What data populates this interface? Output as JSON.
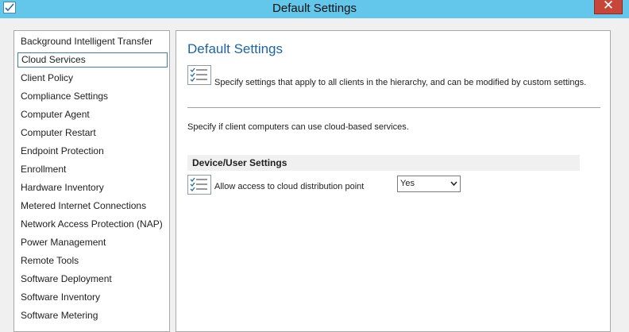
{
  "window": {
    "title": "Default Settings",
    "close_label": "✕"
  },
  "sidebar": {
    "items": [
      {
        "label": "Background Intelligent Transfer",
        "selected": false
      },
      {
        "label": "Cloud Services",
        "selected": true
      },
      {
        "label": "Client Policy",
        "selected": false
      },
      {
        "label": "Compliance Settings",
        "selected": false
      },
      {
        "label": "Computer Agent",
        "selected": false
      },
      {
        "label": "Computer Restart",
        "selected": false
      },
      {
        "label": "Endpoint Protection",
        "selected": false
      },
      {
        "label": "Enrollment",
        "selected": false
      },
      {
        "label": "Hardware Inventory",
        "selected": false
      },
      {
        "label": "Metered Internet Connections",
        "selected": false
      },
      {
        "label": "Network Access Protection (NAP)",
        "selected": false
      },
      {
        "label": "Power Management",
        "selected": false
      },
      {
        "label": "Remote Tools",
        "selected": false
      },
      {
        "label": "Software Deployment",
        "selected": false
      },
      {
        "label": "Software Inventory",
        "selected": false
      },
      {
        "label": "Software Metering",
        "selected": false
      }
    ]
  },
  "main": {
    "title": "Default Settings",
    "description": "Specify settings that apply to all clients in the hierarchy, and can be modified by custom settings.",
    "cloud_text": "Specify if client computers can use cloud-based services.",
    "section_header": "Device/User Settings",
    "setting": {
      "label": "Allow access to cloud distribution point",
      "value": "Yes"
    }
  },
  "colors": {
    "titlebar": "#62c7ea",
    "accent_title": "#1d64a7",
    "close_button": "#c7463a",
    "selection_border": "#3c7fb1"
  },
  "icons": {
    "window": "settings-checklist-icon",
    "description": "checklist-icon",
    "setting": "checklist-icon",
    "dropdown": "chevron-down-icon"
  }
}
